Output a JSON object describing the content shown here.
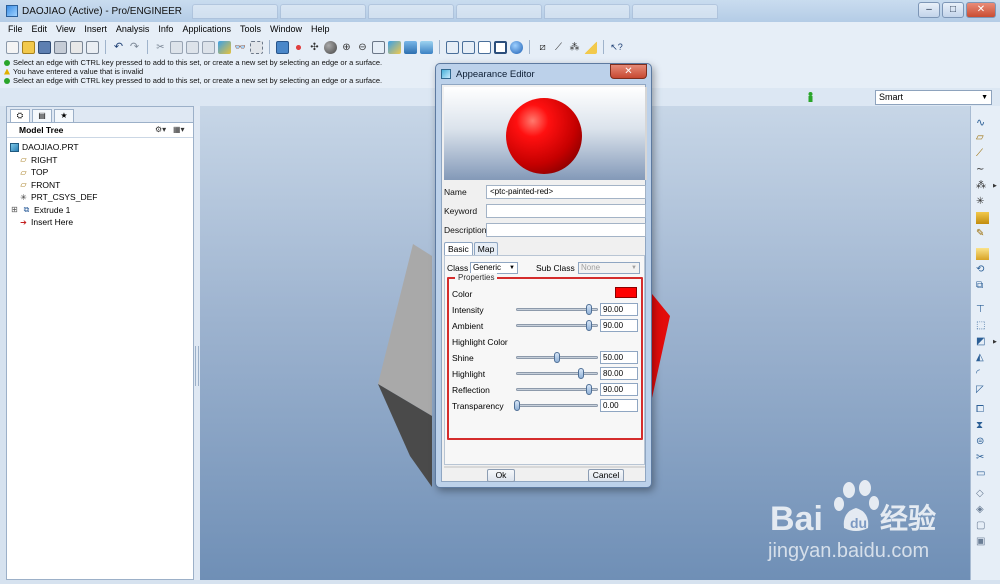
{
  "window": {
    "title": "DAOJIAO (Active) - Pro/ENGINEER",
    "controls": {
      "minimize": "–",
      "maximize": "□",
      "close": "✕"
    }
  },
  "menu": [
    "File",
    "Edit",
    "View",
    "Insert",
    "Analysis",
    "Info",
    "Applications",
    "Tools",
    "Window",
    "Help"
  ],
  "toolbar_icons": [
    "new-icon",
    "open-icon",
    "save-icon",
    "print-icon",
    "email-icon",
    "copy-icon",
    "undo-icon",
    "redo-icon",
    "cut-icon",
    "copy2-icon",
    "paste-icon",
    "paste-special-icon",
    "regenerate-icon",
    "find-icon",
    "select-box-icon",
    "repaint-icon",
    "spin-center-icon",
    "orient-icon",
    "shading-icon",
    "zoom-in-icon",
    "zoom-out-icon",
    "refit-icon",
    "reorient-icon",
    "saved-views-icon",
    "layers-icon",
    "wireframe-icon",
    "hidden-line-icon",
    "no-hidden-icon",
    "shaded-icon",
    "appearance-icon",
    "datum-plane-display-icon",
    "datum-axis-display-icon",
    "point-display-icon",
    "csys-display-icon",
    "context-help-icon"
  ],
  "messages": [
    {
      "type": "ok",
      "color": "#2aa52a",
      "text": "Select an edge with CTRL key pressed to add to this set, or create a new set by selecting an edge or a surface."
    },
    {
      "type": "warning",
      "color": "#e0b000",
      "text": "You have entered a value that is invalid"
    },
    {
      "type": "ok",
      "color": "#2aa52a",
      "text": "Select an edge with CTRL key pressed to add to this set, or create a new set by selecting an edge or a surface."
    }
  ],
  "filter": {
    "value": "Smart"
  },
  "model_tree": {
    "title": "Model Tree",
    "nodes": [
      {
        "label": "DAOJIAO.PRT",
        "icon": "part-icon"
      },
      {
        "label": "RIGHT",
        "icon": "datum-plane-icon"
      },
      {
        "label": "TOP",
        "icon": "datum-plane-icon"
      },
      {
        "label": "FRONT",
        "icon": "datum-plane-icon"
      },
      {
        "label": "PRT_CSYS_DEF",
        "icon": "csys-icon"
      },
      {
        "label": "Extrude 1",
        "icon": "extrude-icon"
      },
      {
        "label": "Insert Here",
        "icon": "insert-here-icon"
      }
    ]
  },
  "dialog": {
    "title": "Appearance Editor",
    "name_label": "Name",
    "name_value": "<ptc-painted-red>",
    "keyword_label": "Keyword",
    "keyword_value": "",
    "description_label": "Description",
    "description_value": "",
    "tabs": [
      "Basic",
      "Map"
    ],
    "class_label": "Class",
    "class_value": "Generic",
    "subclass_label": "Sub Class",
    "subclass_value": "None",
    "properties_legend": "Properties",
    "color_label": "Color",
    "swatch_color": "#ff0000",
    "properties": [
      {
        "label": "Intensity",
        "value": "90.00",
        "level": 0.9
      },
      {
        "label": "Ambient",
        "value": "90.00",
        "level": 0.9
      }
    ],
    "highlight_color_label": "Highlight Color",
    "highlight_properties": [
      {
        "label": "Shine",
        "value": "50.00",
        "level": 0.5
      },
      {
        "label": "Highlight",
        "value": "80.00",
        "level": 0.8
      },
      {
        "label": "Reflection",
        "value": "90.00",
        "level": 0.9
      },
      {
        "label": "Transparency",
        "value": "0.00",
        "level": 0.0
      }
    ],
    "ok_label": "Ok",
    "cancel_label": "Cancel"
  },
  "watermark": {
    "url": "jingyan.baidu.com"
  }
}
